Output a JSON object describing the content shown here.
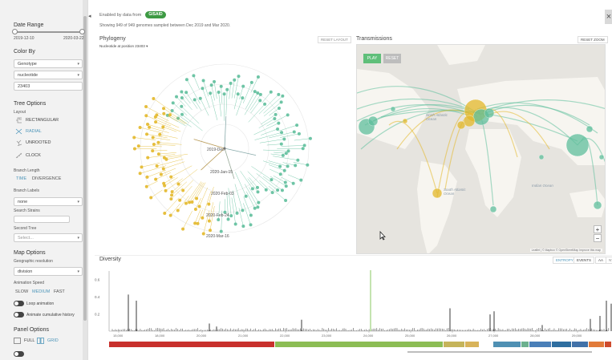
{
  "sidebar": {
    "date_range": {
      "title": "Date Range",
      "start": "2019-12-10",
      "end": "2020-03-22"
    },
    "color_by": {
      "title": "Color By",
      "select1": "Genotype",
      "select2": "nucleotide",
      "input": "23403"
    },
    "tree_options": {
      "title": "Tree Options",
      "layout_label": "Layout",
      "layouts": [
        "RECTANGULAR",
        "RADIAL",
        "UNROOTED",
        "CLOCK"
      ],
      "branch_length_label": "Branch Length",
      "branch_length_options": [
        "TIME",
        "DIVERGENCE"
      ],
      "branch_labels_label": "Branch Labels",
      "branch_labels_value": "none",
      "search_strains_label": "Search Strains",
      "second_tree_label": "Second Tree",
      "second_tree_value": "Select..."
    },
    "map_options": {
      "title": "Map Options",
      "geo_res_label": "Geographic resolution",
      "geo_res_value": "division",
      "anim_speed_label": "Animation Speed",
      "speeds": [
        "SLOW",
        "MEDIUM",
        "FAST"
      ],
      "loop_label": "Loop animation",
      "cumulative_label": "Animate cumulative history"
    },
    "panel_options": {
      "title": "Panel Options",
      "full": "FULL",
      "grid": "GRID"
    }
  },
  "header": {
    "enabled_by": "Enabled by data from",
    "gisaid": "GISAID",
    "showing": "Showing 949 of 949 genomes sampled between Dec 2019 and Mar 2020."
  },
  "phylogeny": {
    "title": "Phylogeny",
    "subtitle": "Nucleotide at position 23403",
    "reset_layout": "RESET LAYOUT",
    "date_labels": [
      "2019-Dec-",
      "2020-Jan-15",
      "2020-Feb-03",
      "2020-Feb-24",
      "2020-Mar-16"
    ]
  },
  "transmissions": {
    "title": "Transmissions",
    "reset_zoom": "RESET ZOOM",
    "play": "PLAY",
    "reset": "RESET",
    "zoom_in": "+",
    "zoom_out": "−",
    "attribution": "Leaflet | © Mapbox © OpenStreetMap Improve this map",
    "labels": [
      "North Atlantic Ocean",
      "South Atlantic Ocean",
      "Indian Ocean"
    ]
  },
  "diversity": {
    "title": "Diversity",
    "entropy": "ENTROPY",
    "events": "EVENTS",
    "aa": "AA",
    "nt": "NT",
    "y_ticks": [
      "0.6",
      "0.4",
      "0.2"
    ],
    "x_ticks": [
      "15,000",
      "18,000",
      "20,000",
      "21,000",
      "22,000",
      "23,000",
      "24,000",
      "25,000",
      "26,000",
      "27,000",
      "28,000",
      "29,000"
    ]
  },
  "colors": {
    "yellow": "#e3b82a",
    "green": "#5fbf9c",
    "accent": "#5097ba",
    "gisaid": "#3d9a43"
  }
}
